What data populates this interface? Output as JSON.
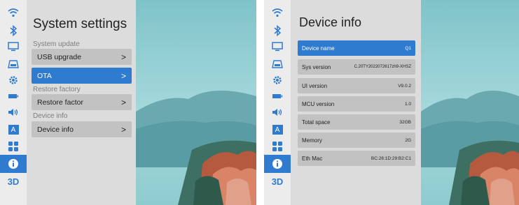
{
  "left_screen": {
    "title": "System settings",
    "sections": [
      {
        "label": "System update",
        "item": "USB upgrade"
      },
      {
        "item": "OTA"
      },
      {
        "label": "Restore factory",
        "item": "Restore factor"
      },
      {
        "label": "Device info",
        "item": "Device info"
      }
    ],
    "chevron": ">",
    "selected_item": "OTA"
  },
  "right_screen": {
    "title": "Device info",
    "rows": [
      {
        "key": "Device name",
        "value": "Q1"
      },
      {
        "key": "Sys version",
        "value": "C.20TY2022072617zh9-XHSZ"
      },
      {
        "key": "UI version",
        "value": "V9.0.2"
      },
      {
        "key": "MCU version",
        "value": "1.0"
      },
      {
        "key": "Total space",
        "value": "32GB"
      },
      {
        "key": "Memory",
        "value": "2G"
      },
      {
        "key": "Eth Mac",
        "value": "BC:26:1D:29:B2:C1"
      }
    ],
    "selected_row": "Device name"
  },
  "sidebar": {
    "icons": [
      "wifi-icon",
      "bluetooth-icon",
      "display-icon",
      "projector-icon",
      "gear-icon",
      "battery-icon",
      "speaker-icon",
      "language-icon",
      "apps-icon",
      "info-icon"
    ],
    "label_3d": "3D",
    "language_glyph": "A",
    "active": "info-icon"
  },
  "colors": {
    "accent": "#2f7bd0",
    "sidebar_bg": "#ececec",
    "panel_bg": "#dcdcdc",
    "row_bg": "#c2c2c2"
  }
}
